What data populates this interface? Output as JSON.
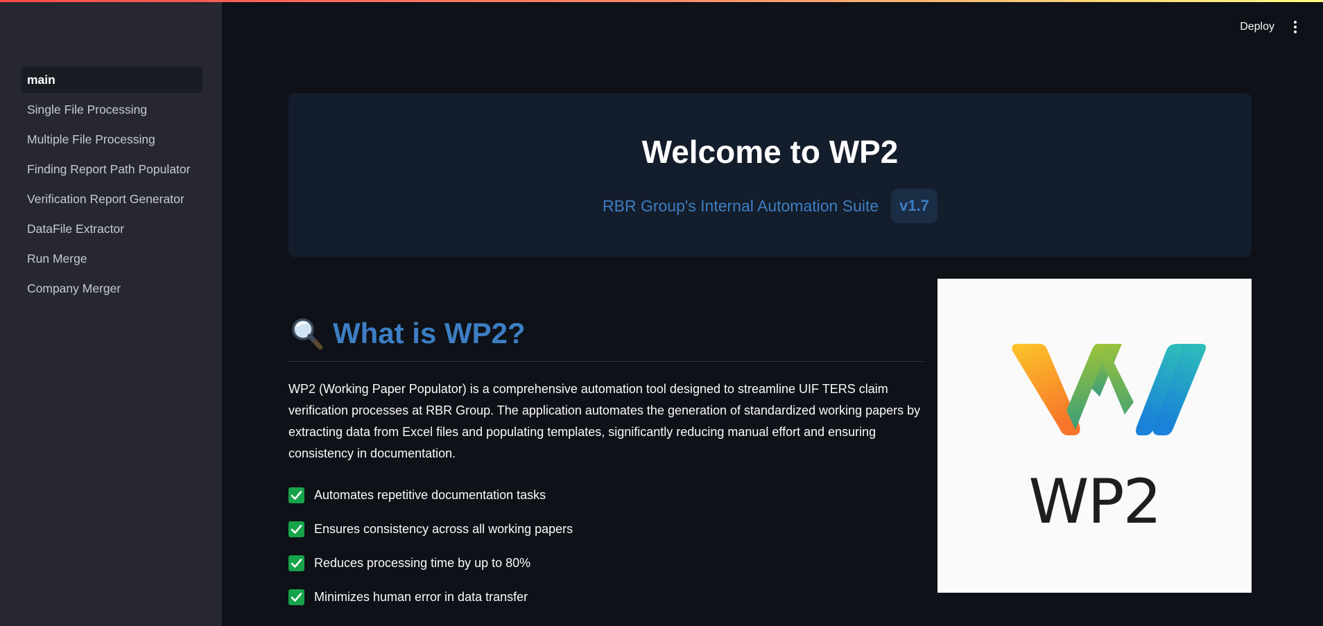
{
  "sidebar": {
    "items": [
      {
        "label": "main",
        "active": true
      },
      {
        "label": "Single File Processing"
      },
      {
        "label": "Multiple File Processing"
      },
      {
        "label": "Finding Report Path Populator"
      },
      {
        "label": "Verification Report Generator"
      },
      {
        "label": "DataFile Extractor"
      },
      {
        "label": "Run Merge"
      },
      {
        "label": "Company Merger"
      }
    ]
  },
  "header": {
    "deploy_label": "Deploy",
    "menu_icon": "kebab-menu-icon"
  },
  "hero": {
    "title": "Welcome to WP2",
    "subtitle": "RBR Group's Internal Automation Suite",
    "version": "v1.7"
  },
  "about": {
    "icon": "magnifier-icon",
    "heading": "What is WP2?",
    "description": "WP2 (Working Paper Populator) is a comprehensive automation tool designed to streamline UIF TERS claim verification processes at RBR Group. The application automates the generation of standardized working papers by extracting data from Excel files and populating templates, significantly reducing manual effort and ensuring consistency in documentation.",
    "features": [
      "Automates repetitive documentation tasks",
      "Ensures consistency across all working papers",
      "Reduces processing time by up to 80%",
      "Minimizes human error in data transfer"
    ]
  },
  "logo": {
    "text": "WP2"
  },
  "colors": {
    "background": "#0e1117",
    "sidebar": "#262730",
    "accent_blue": "#3d7ec4",
    "hero_panel": "#141d2b",
    "check_green": "#16a34a"
  }
}
